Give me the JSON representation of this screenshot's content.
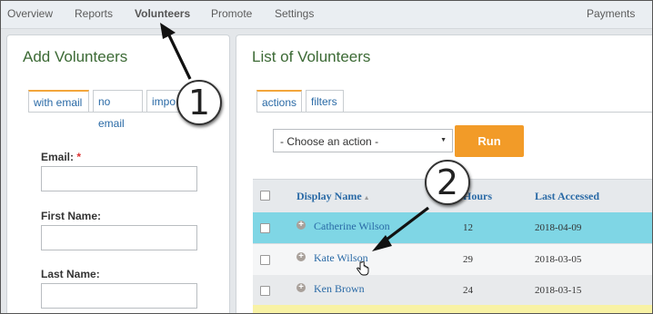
{
  "nav": {
    "items": [
      "Overview",
      "Reports",
      "Volunteers",
      "Promote",
      "Settings"
    ],
    "right_item": "Payments",
    "active": "Volunteers"
  },
  "add_panel": {
    "title": "Add Volunteers",
    "tabs": [
      "with email",
      "no email",
      "impo"
    ],
    "fields": [
      {
        "label": "Email:",
        "required_mark": "*",
        "value": ""
      },
      {
        "label": "First Name:",
        "value": ""
      },
      {
        "label": "Last Name:",
        "value": ""
      }
    ]
  },
  "list_panel": {
    "title": "List of Volunteers",
    "tabs": [
      "actions",
      "filters"
    ],
    "action_select": "- Choose an action -",
    "run_label": "Run",
    "columns": [
      "Display Name",
      "Hours",
      "Last Accessed"
    ],
    "rows": [
      {
        "name": "Catherine Wilson",
        "hours": "12",
        "last_accessed": "2018-04-09",
        "highlighted": true
      },
      {
        "name": "Kate Wilson",
        "hours": "29",
        "last_accessed": "2018-03-05",
        "highlighted": false
      },
      {
        "name": "Ken Brown",
        "hours": "24",
        "last_accessed": "2018-03-15",
        "highlighted": false
      }
    ]
  },
  "annotations": {
    "callout_1": "1",
    "callout_2": "2"
  },
  "colors": {
    "accent_orange": "#f29b28",
    "link_blue": "#2a6aa6",
    "title_green": "#3c6a35",
    "highlight_row": "#7fd6e5"
  }
}
